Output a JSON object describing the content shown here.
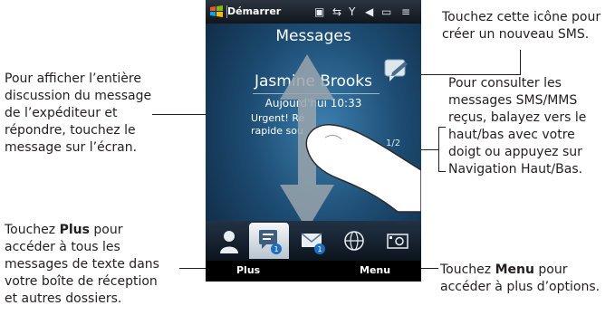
{
  "phone": {
    "start_label": "Démarrer",
    "title": "Messages",
    "sender": "Jasmine Brooks",
    "date": "Aujourd'hui 10:33",
    "message_line1": "Urgent! Ré",
    "message_line2": "rapide sou",
    "counter": "1/2",
    "soft_left": "Plus",
    "soft_right": "Menu"
  },
  "callouts": {
    "top_right": [
      "Touchez cette icône pour",
      "créer un nouveau SMS."
    ],
    "left_top": [
      "Pour afficher l’entière",
      "discussion du message",
      "de l’expéditeur et",
      "répondre, touchez le",
      "message sur l’écran."
    ],
    "right_mid": [
      "Pour consulter les",
      "messages SMS/MMS",
      "reçus, balayez vers le",
      "haut/bas avec votre",
      "doigt ou appuyez sur",
      "Navigation Haut/Bas."
    ],
    "left_bottom": {
      "l1_pre": "Touchez ",
      "l1_bold": "Plus",
      "l1_post": " pour",
      "l2": "accéder à tous les",
      "l3": "messages de texte dans",
      "l4": "votre boîte de réception",
      "l5": "et autres dossiers."
    },
    "right_bottom": {
      "l1_pre": "Touchez ",
      "l1_bold": "Menu",
      "l1_post": " pour",
      "l2": "accéder à plus d’options."
    }
  },
  "colors": {
    "text": "#231f20",
    "screen_dark": "#0c2238",
    "screen_light": "#3b7fae"
  }
}
